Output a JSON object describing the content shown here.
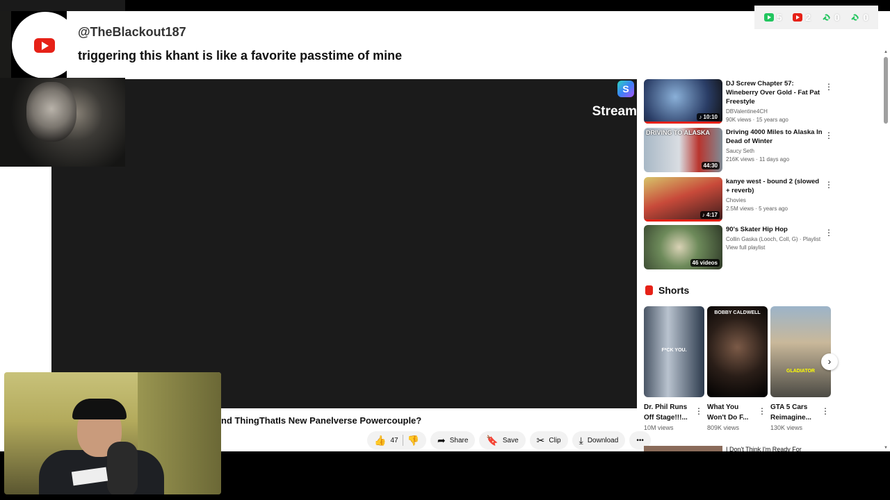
{
  "overlay_stats": [
    {
      "icon": "green-play-icon",
      "value": "5",
      "color": "#22c55e"
    },
    {
      "icon": "youtube-icon",
      "value": "2",
      "color": "#e62117"
    },
    {
      "icon": "link-icon",
      "value": "0",
      "color": "#22c55e"
    },
    {
      "icon": "link-icon",
      "value": "0",
      "color": "#22c55e"
    }
  ],
  "comment": {
    "user": "@TheBlackout187",
    "text": "triggering this khant is like a favorite passtime of mine"
  },
  "player": {
    "stream_label": "Stream"
  },
  "video": {
    "title": "nd ThingThatIs New Panelverse Powercouple?",
    "likes": "47",
    "share": "Share",
    "save": "Save",
    "clip": "Clip",
    "download": "Download",
    "more": "•••"
  },
  "recommendations": [
    {
      "title": "DJ Screw Chapter 57: Wineberry Over Gold - Fat Pat Freestyle",
      "channel": "DBValentine4CH",
      "meta": "90K views · 15 years ago",
      "duration": "♪ 10:10"
    },
    {
      "title": "Driving 4000 Miles to Alaska In Dead of Winter",
      "channel": "Saucy Seth",
      "meta": "216K views · 11 days ago",
      "duration": "44:30",
      "thumb_text": "DRIVING TO ALASKA"
    },
    {
      "title": "kanye west - bound 2 (slowed + reverb)",
      "channel": "Chovies",
      "meta": "2.5M views · 5 years ago",
      "duration": "♪ 4:17"
    },
    {
      "title": "90's Skater Hip Hop",
      "channel": "Collin Gaska (Looch, Coll, G) · Playlist",
      "meta": "View full playlist",
      "duration": "46 videos"
    }
  ],
  "shorts": {
    "heading": "Shorts",
    "items": [
      {
        "title": "Dr. Phil Runs Off Stage!!!...",
        "views": "10M views",
        "caption": "F*CK YOU."
      },
      {
        "title": "What You Won't Do F...",
        "views": "809K views",
        "caption": "BOBBY CALDWELL"
      },
      {
        "title": "GTA 5 Cars Reimagine...",
        "views": "130K views",
        "caption": "GLADIATOR"
      }
    ]
  },
  "cut_item": {
    "title": "I Don't Think I'm Ready For"
  }
}
